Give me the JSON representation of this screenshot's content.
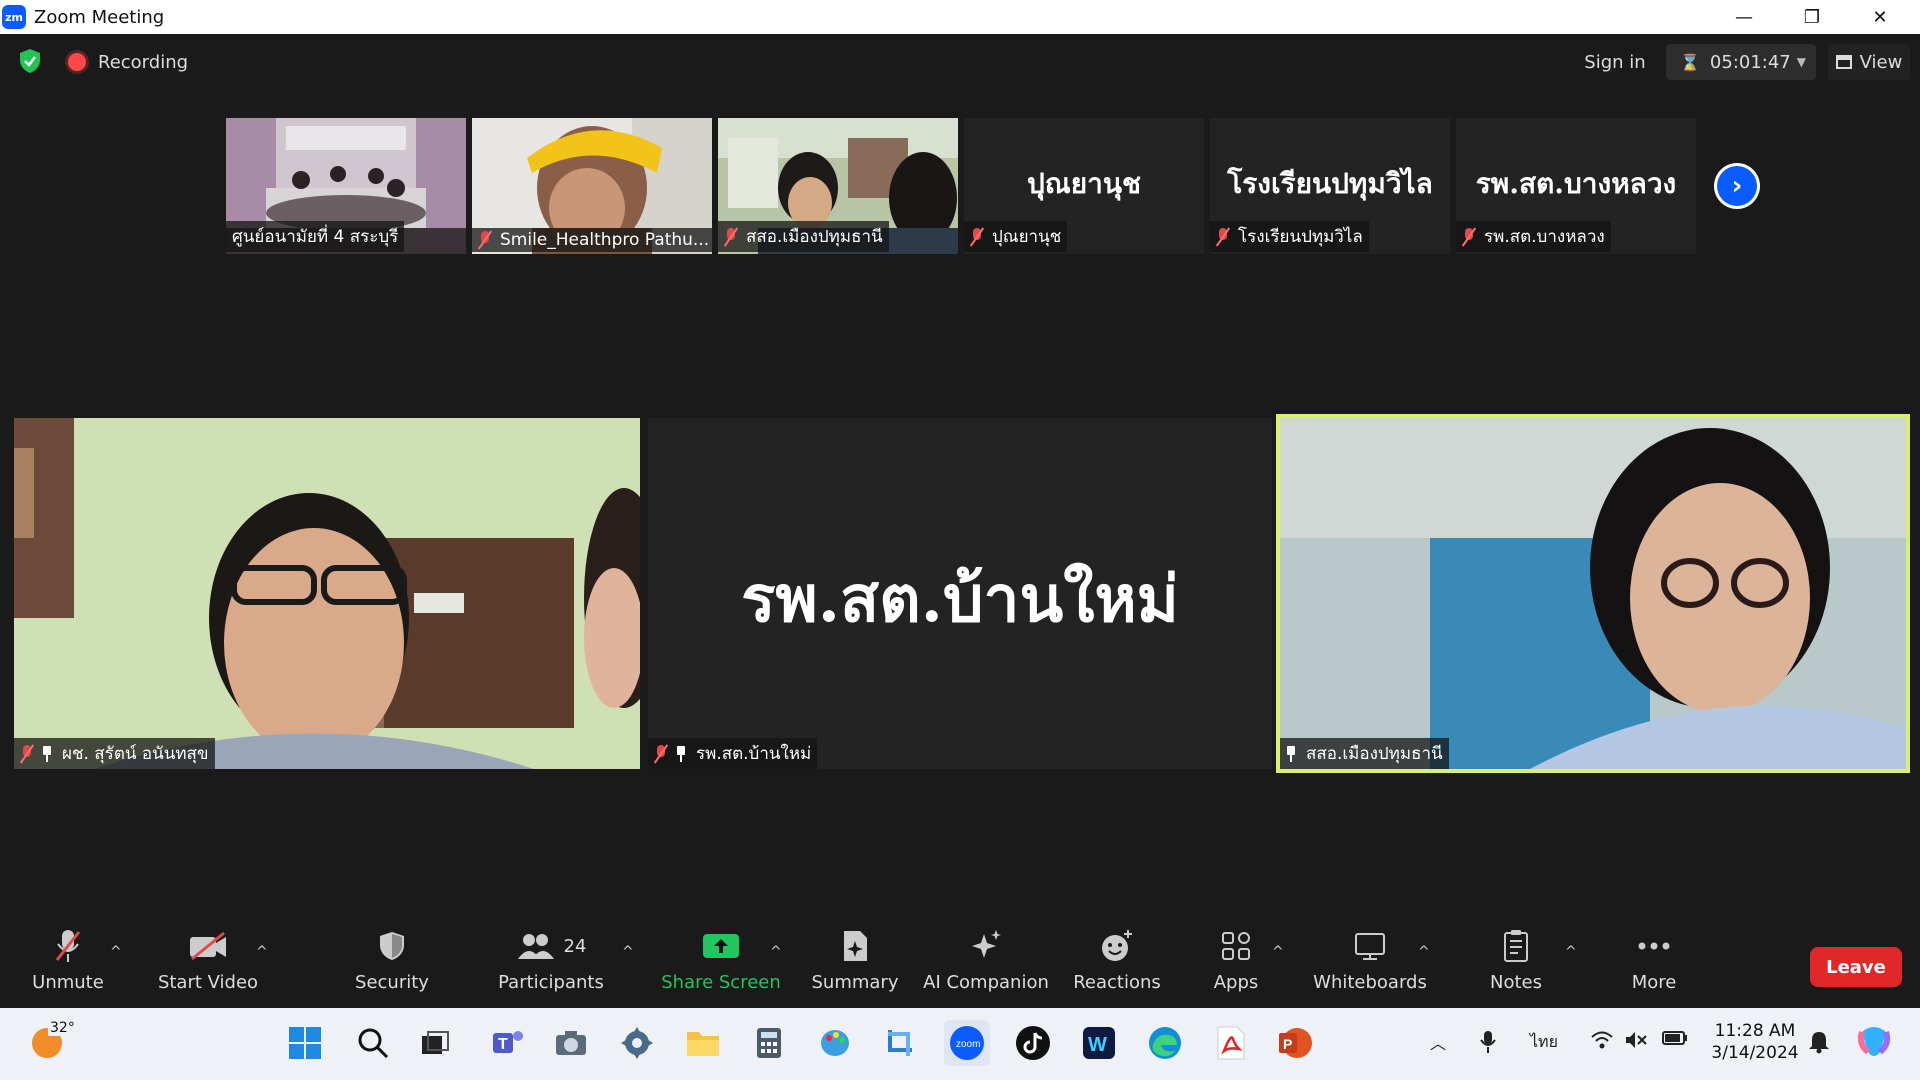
{
  "window": {
    "title": "Zoom Meeting"
  },
  "topbar": {
    "recording_label": "Recording",
    "sign_in": "Sign in",
    "timer": "05:01:47",
    "view_label": "View"
  },
  "strip": [
    {
      "name": "ศูนย์อนามัยที่ 4 สระบุรี",
      "type": "video",
      "muted": false
    },
    {
      "name": "Smile_Healthpro Pathu...",
      "type": "video",
      "muted": true
    },
    {
      "name": "สสอ.เมืองปทุมธานี",
      "type": "video",
      "muted": true
    },
    {
      "name": "ปุณยานุช",
      "display": "ปุณยานุช",
      "type": "name",
      "muted": true
    },
    {
      "name": "โรงเรียนปทุมวิไล",
      "display": "โรงเรียนปทุมวิไล",
      "type": "name",
      "muted": true
    },
    {
      "name": "รพ.สต.บางหลวง",
      "display": "รพ.สต.บางหลวง",
      "type": "name",
      "muted": true
    }
  ],
  "main": [
    {
      "name": "ผช. สุรัตน์ อนันทสุข",
      "muted": true,
      "pinned": true
    },
    {
      "name": "รพ.สต.บ้านใหม่",
      "display": "รพ.สต.บ้านใหม่",
      "muted": true,
      "pinned": true
    },
    {
      "name": "สสอ.เมืองปทุมธานี",
      "muted": false,
      "pinned": true,
      "active_speaker": true
    }
  ],
  "toolbar": {
    "unmute": "Unmute",
    "start_video": "Start Video",
    "security": "Security",
    "participants": "Participants",
    "participants_count": "24",
    "share_screen": "Share Screen",
    "summary": "Summary",
    "ai_companion": "AI Companion",
    "reactions": "Reactions",
    "apps": "Apps",
    "whiteboards": "Whiteboards",
    "notes": "Notes",
    "more": "More",
    "leave": "Leave"
  },
  "taskbar": {
    "temperature": "32°",
    "language": "ไทย",
    "time": "11:28 AM",
    "date": "3/14/2024",
    "zoom_label": "zoom"
  },
  "colors": {
    "accent": "#0b5cff",
    "active_border": "#d8f06a",
    "share_green": "#22c55e",
    "leave_red": "#e02828"
  }
}
